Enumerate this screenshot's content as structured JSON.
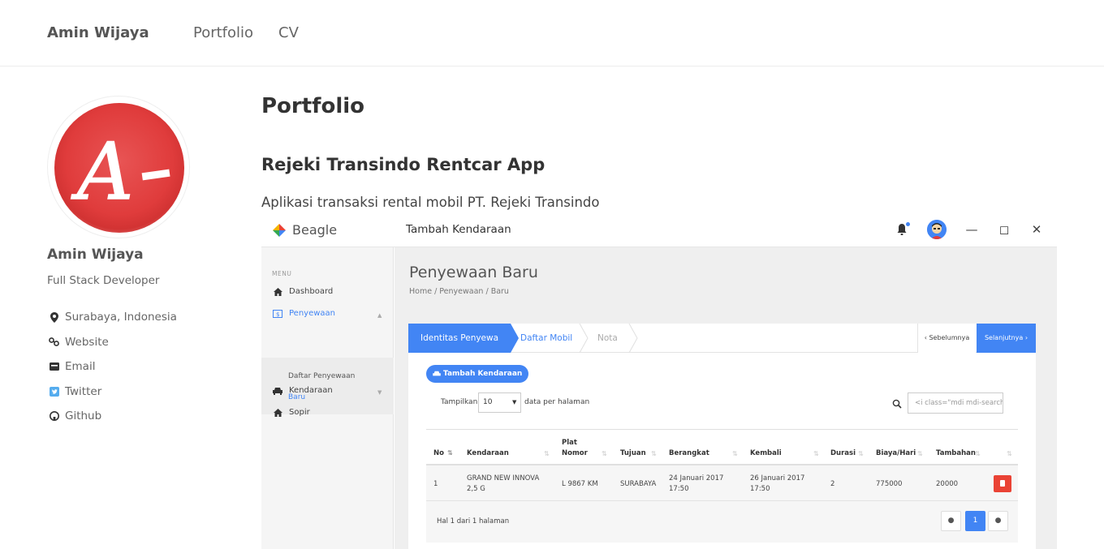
{
  "nav": {
    "brand": "Amin Wijaya",
    "links": [
      "Portfolio",
      "CV"
    ]
  },
  "profile": {
    "name": "Amin Wijaya",
    "role": "Full Stack Developer",
    "info": [
      {
        "icon": "map-marker-icon",
        "label": "Surabaya, Indonesia"
      },
      {
        "icon": "link-icon",
        "label": "Website"
      },
      {
        "icon": "email-icon",
        "label": "Email"
      },
      {
        "icon": "twitter-icon",
        "label": "Twitter"
      },
      {
        "icon": "github-icon",
        "label": "Github"
      }
    ]
  },
  "main": {
    "title": "Portfolio",
    "project_title": "Rejeki Transindo Rentcar App",
    "project_desc": "Aplikasi transaksi rental mobil PT. Rejeki Transindo"
  },
  "screenshot": {
    "app_name": "Beagle",
    "window_title": "Tambah Kendaraan",
    "menu_label": "MENU",
    "sidebar": {
      "dashboard": "Dashboard",
      "penyewaan": "Penyewaan",
      "daftar_penyewaan": "Daftar Penyewaan",
      "baru": "Baru",
      "kendaraan": "Kendaraan",
      "sopir": "Sopir"
    },
    "page_heading": "Penyewaan Baru",
    "breadcrumb": "Home  /  Penyewaan  /  Baru",
    "wizard": {
      "step1": "Identitas Penyewa",
      "step2": "Daftar Mobil",
      "step3": "Nota",
      "prev": "‹ Sebelumnya",
      "next": "Selanjutnya ›"
    },
    "add_button": "Tambah Kendaraan",
    "show_label": "Tampilkan",
    "per_page_value": "10",
    "per_page_label": "data per halaman",
    "search_placeholder": "<i class=\"mdi mdi-search",
    "table": {
      "headers": {
        "no": "No",
        "kendaraan": "Kendaraan",
        "plat1": "Plat",
        "plat2": "Nomor",
        "tujuan": "Tujuan",
        "berangkat": "Berangkat",
        "kembali": "Kembali",
        "durasi": "Durasi",
        "biaya": "Biaya/Hari",
        "tambahan": "Tambahan"
      },
      "row": {
        "no": "1",
        "kendaraan1": "GRAND NEW INNOVA",
        "kendaraan2": "2,5 G",
        "plat": "L 9867 KM",
        "tujuan": "SURABAYA",
        "berangkat1": "24 Januari 2017",
        "berangkat2": "17:50",
        "kembali1": "26 Januari 2017",
        "kembali2": "17:50",
        "durasi": "2",
        "biaya": "775000",
        "tambahan": "20000"
      }
    },
    "page_info": "Hal 1 dari 1 halaman",
    "current_page": "1"
  },
  "colors": {
    "accent": "#4285f4",
    "danger": "#ea4335",
    "avatar_red": "#e03c3c"
  }
}
